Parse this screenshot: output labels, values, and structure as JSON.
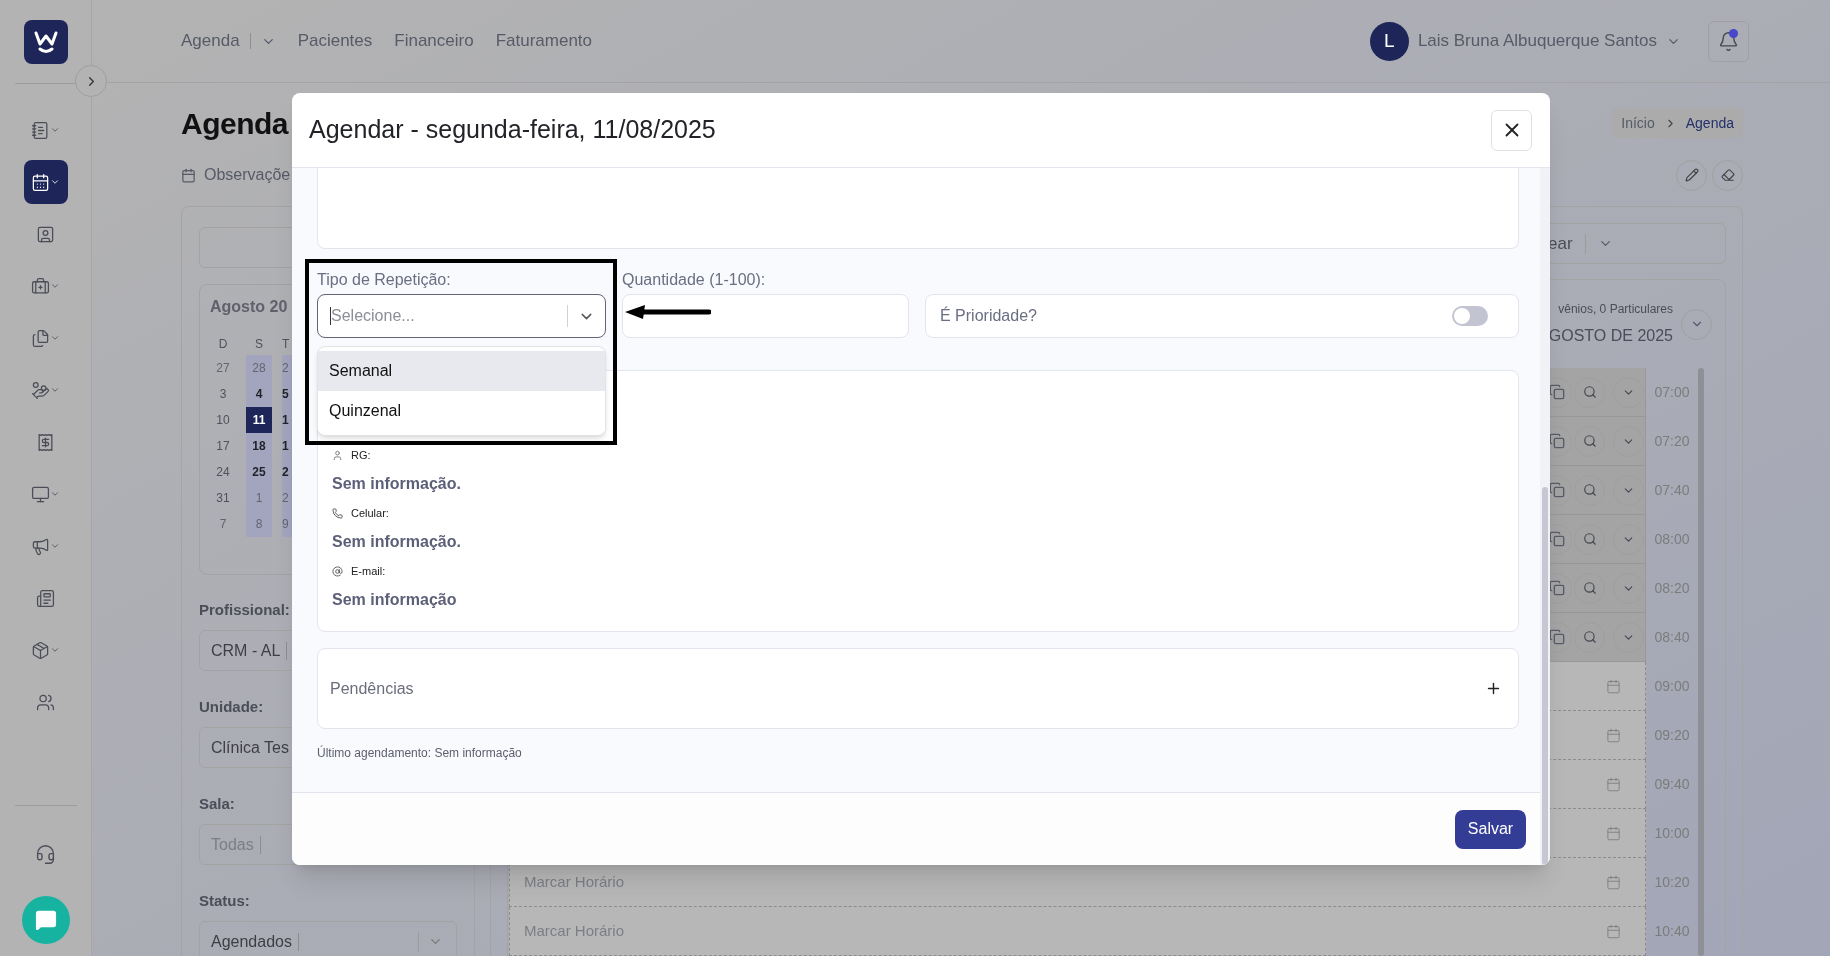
{
  "sidebar": {
    "items": [
      {
        "selected": false,
        "submenu": true
      },
      {
        "selected": true,
        "submenu": true
      },
      {
        "selected": false,
        "submenu": false
      },
      {
        "selected": false,
        "submenu": true
      },
      {
        "selected": false,
        "submenu": true
      },
      {
        "selected": false,
        "submenu": true
      },
      {
        "selected": false,
        "submenu": false
      },
      {
        "selected": false,
        "submenu": true
      },
      {
        "selected": false,
        "submenu": true
      },
      {
        "selected": false,
        "submenu": false
      },
      {
        "selected": false,
        "submenu": true
      },
      {
        "selected": false,
        "submenu": false
      }
    ]
  },
  "top_nav": {
    "links": [
      {
        "label": "Agenda",
        "menu": true
      },
      {
        "label": "Pacientes",
        "menu": false
      },
      {
        "label": "Financeiro",
        "menu": false
      },
      {
        "label": "Faturamento",
        "menu": false
      }
    ],
    "user": {
      "initial": "L",
      "name": "Lais Bruna Albuquerque Santos"
    },
    "notifications": {
      "unread": true
    }
  },
  "page": {
    "title": "Agenda",
    "notes_link": "Observaçõe",
    "breadcrumb": [
      {
        "label": "Início",
        "current": false
      },
      {
        "label": "Agenda",
        "current": true
      }
    ]
  },
  "filters": {
    "calendar": {
      "month": "Agosto  20",
      "weekdays": [
        "D",
        "S",
        "T"
      ],
      "weeks": [
        [
          {
            "day": "27",
            "muted": true,
            "highlighted": false,
            "selected": false
          },
          {
            "day": "28",
            "muted": true,
            "highlighted": true,
            "selected": false
          },
          {
            "day": "2",
            "muted": true,
            "highlighted": true,
            "selected": false
          }
        ],
        [
          {
            "day": "3",
            "muted": false,
            "highlighted": false,
            "selected": false
          },
          {
            "day": "4",
            "muted": false,
            "highlighted": true,
            "selected": false
          },
          {
            "day": "5",
            "muted": false,
            "highlighted": true,
            "selected": false
          }
        ],
        [
          {
            "day": "10",
            "muted": false,
            "highlighted": false,
            "selected": false
          },
          {
            "day": "11",
            "muted": false,
            "highlighted": true,
            "selected": true
          },
          {
            "day": "1",
            "muted": false,
            "highlighted": true,
            "selected": false
          }
        ],
        [
          {
            "day": "17",
            "muted": false,
            "highlighted": false,
            "selected": false
          },
          {
            "day": "18",
            "muted": false,
            "highlighted": true,
            "selected": false
          },
          {
            "day": "1",
            "muted": false,
            "highlighted": true,
            "selected": false
          }
        ],
        [
          {
            "day": "24",
            "muted": false,
            "highlighted": false,
            "selected": false
          },
          {
            "day": "25",
            "muted": false,
            "highlighted": true,
            "selected": false
          },
          {
            "day": "2",
            "muted": false,
            "highlighted": true,
            "selected": false
          }
        ],
        [
          {
            "day": "31",
            "muted": false,
            "highlighted": false,
            "selected": false
          },
          {
            "day": "1",
            "muted": true,
            "highlighted": true,
            "selected": false
          },
          {
            "day": "2",
            "muted": true,
            "highlighted": true,
            "selected": false
          }
        ],
        [
          {
            "day": "7",
            "muted": true,
            "highlighted": false,
            "selected": false
          },
          {
            "day": "8",
            "muted": true,
            "highlighted": true,
            "selected": false
          },
          {
            "day": "9",
            "muted": true,
            "highlighted": true,
            "selected": false
          }
        ]
      ]
    },
    "fields": [
      {
        "label": "Profissional:",
        "value": "CRM - AL"
      },
      {
        "label": "Unidade:",
        "value": "Clínica Tes"
      },
      {
        "label": "Sala:",
        "placeholder": "Todas"
      },
      {
        "label": "Status:",
        "value": "Agendados"
      }
    ]
  },
  "schedule": {
    "view_select": "ear",
    "summary": "vênios, 0 Particulares",
    "date": "GOSTO DE 2025",
    "slots": [
      {
        "time": "07:00",
        "booked": true
      },
      {
        "time": "07:20",
        "booked": true
      },
      {
        "time": "07:40",
        "booked": true
      },
      {
        "time": "08:00",
        "booked": true
      },
      {
        "time": "08:20",
        "booked": true
      },
      {
        "time": "08:40",
        "booked": true
      },
      {
        "time": "09:00",
        "booked": false
      },
      {
        "time": "09:20",
        "booked": false
      },
      {
        "time": "09:40",
        "booked": false
      },
      {
        "time": "10:00",
        "booked": false
      },
      {
        "time": "10:20",
        "booked": false,
        "label": "Marcar Horário"
      },
      {
        "time": "10:40",
        "booked": false,
        "label": "Marcar Horário"
      }
    ]
  },
  "modal": {
    "title": "Agendar - segunda-feira, 11/08/2025",
    "repeat": {
      "label": "Tipo de Repetição:",
      "placeholder": "Selecione...",
      "open": true,
      "options": [
        {
          "label": "Semanal",
          "selected": true
        },
        {
          "label": "Quinzenal",
          "selected": false
        }
      ]
    },
    "quantity": {
      "label": "Quantidade (1-100):"
    },
    "priority": {
      "label": "É Prioridade?",
      "on": false
    },
    "patient_info": [
      {
        "kind": "id",
        "label": "RG:",
        "value": "Sem informação."
      },
      {
        "kind": "phone",
        "label": "Celular:",
        "value": "Sem informação."
      },
      {
        "kind": "email",
        "label": "E-mail:",
        "value": "Sem informação"
      }
    ],
    "pendencies": {
      "label": "Pendências"
    },
    "last_appointment": "Último agendamento: Sem informação",
    "save": "Salvar"
  }
}
